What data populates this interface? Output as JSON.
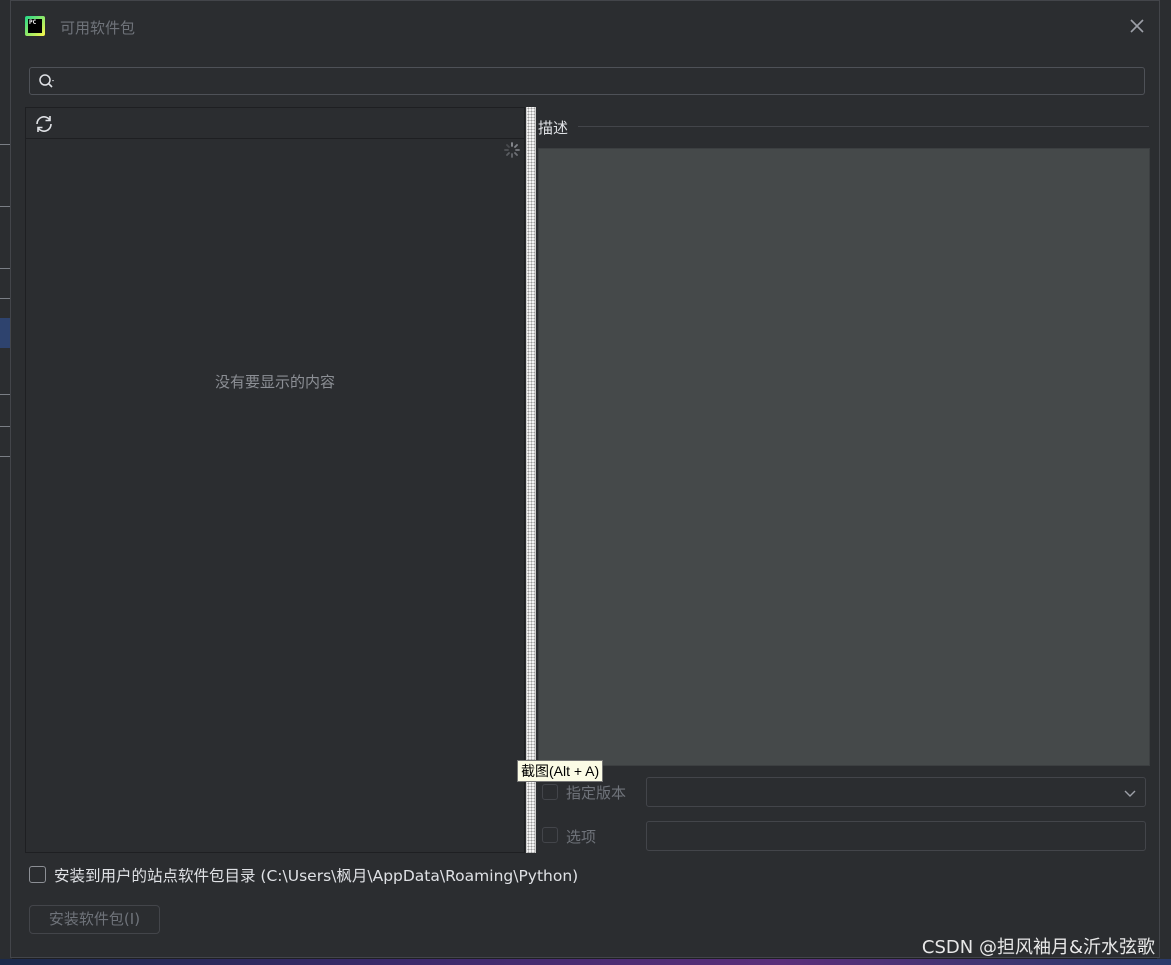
{
  "window": {
    "title": "可用软件包",
    "app_icon": {
      "name": "pycharm-logo-icon",
      "text": "PC"
    },
    "close_icon": "close-icon"
  },
  "search": {
    "value": "",
    "placeholder": "",
    "icon": "search-icon"
  },
  "packages_panel": {
    "refresh_icon": "refresh-icon",
    "loading_icon": "spinner-icon",
    "empty_text": "没有要显示的内容"
  },
  "description": {
    "label": "描述",
    "content": ""
  },
  "tooltip": {
    "text": "截图(Alt + A)"
  },
  "options": {
    "specify_version": {
      "label": "指定版本",
      "checked": false,
      "value": ""
    },
    "options": {
      "label": "选项",
      "checked": false,
      "value": ""
    }
  },
  "install_to_user": {
    "label": "安装到用户的站点软件包目录 (C:\\Users\\枫月\\AppData\\Roaming\\Python)",
    "checked": false
  },
  "install_button": {
    "label": "安装软件包(I)"
  },
  "watermark": {
    "text": "CSDN @担风袖月&沂水弦歌"
  },
  "colors": {
    "dialog_bg": "#2b2d30",
    "description_bg": "#45494a",
    "tooltip_bg": "#fbfbe5",
    "muted_text": "#6f737a"
  }
}
